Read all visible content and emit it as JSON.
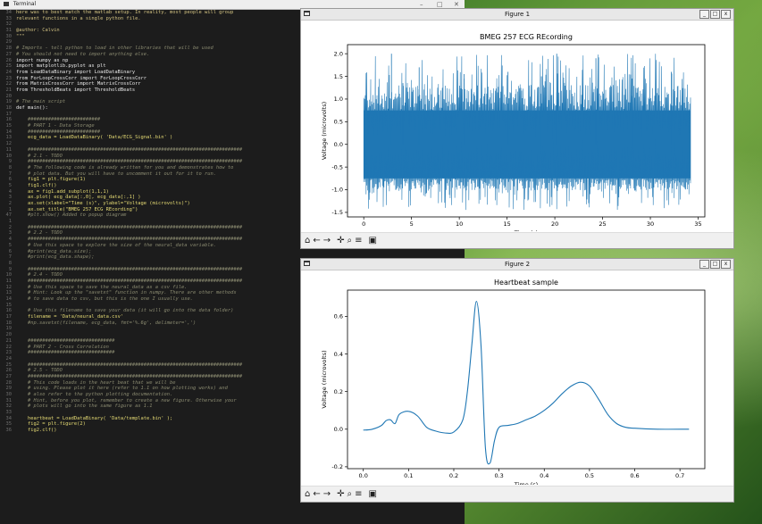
{
  "terminal": {
    "title": "Terminal",
    "controls": [
      "–",
      "□",
      "✕"
    ],
    "lines": [
      {
        "n": "34",
        "t": "here was to best match the matlab setup. In reality, most people will group",
        "k": "hdr"
      },
      {
        "n": "33",
        "t": "relevant functions in a single python file.",
        "k": "hdr"
      },
      {
        "n": "32",
        "t": "",
        "k": ""
      },
      {
        "n": "31",
        "t": "@author: Calvin",
        "k": "hdr"
      },
      {
        "n": "30",
        "t": "\"\"\"",
        "k": "hdr"
      },
      {
        "n": "29",
        "t": "",
        "k": ""
      },
      {
        "n": "28",
        "t": "# Imports - tell python to load in other libraries that will be used",
        "k": "cmt"
      },
      {
        "n": "27",
        "t": "# You should not need to import anything else.",
        "k": "cmt"
      },
      {
        "n": "26",
        "t": "import numpy as np",
        "k": "kw"
      },
      {
        "n": "25",
        "t": "import matplotlib.pyplot as plt",
        "k": "kw"
      },
      {
        "n": "24",
        "t": "from LoadDataBinary import LoadDataBinary",
        "k": "kw"
      },
      {
        "n": "23",
        "t": "from ForLoopCrossCorr import ForLoopCrossCorr",
        "k": "kw"
      },
      {
        "n": "22",
        "t": "from MatrixCrossCorr import MatrixCrossCorr",
        "k": "kw"
      },
      {
        "n": "21",
        "t": "from ThresholdBeats import ThresholdBeats",
        "k": "kw"
      },
      {
        "n": "20",
        "t": "",
        "k": ""
      },
      {
        "n": "19",
        "t": "# The main script",
        "k": "cmt"
      },
      {
        "n": "18",
        "t": "def main():",
        "k": "kw"
      },
      {
        "n": "17",
        "t": "",
        "k": ""
      },
      {
        "n": "16",
        "t": "    #########################",
        "k": "cmt"
      },
      {
        "n": "15",
        "t": "    # PART 1 - Data Storage",
        "k": "cmt"
      },
      {
        "n": "14",
        "t": "    #########################",
        "k": "cmt"
      },
      {
        "n": "13",
        "t": "    ecg_data = LoadDataBinary( 'Data/ECG_Signal.bin' )",
        "k": ""
      },
      {
        "n": "12",
        "t": "",
        "k": ""
      },
      {
        "n": "11",
        "t": "    ##########################################################################",
        "k": "cmt"
      },
      {
        "n": "10",
        "t": "    # 2.1 - TODO",
        "k": "cmt"
      },
      {
        "n": "9",
        "t": "    ##########################################################################",
        "k": "cmt"
      },
      {
        "n": "8",
        "t": "    # The following code is already written for you and demonstrates how to",
        "k": "cmt"
      },
      {
        "n": "7",
        "t": "    # plot data. But you will have to uncomment it out for it to run.",
        "k": "cmt"
      },
      {
        "n": "6",
        "t": "    fig1 = plt.figure(1)",
        "k": ""
      },
      {
        "n": "5",
        "t": "    fig1.clf()",
        "k": ""
      },
      {
        "n": "4",
        "t": "    ax = fig1.add_subplot(1,1,1)",
        "k": ""
      },
      {
        "n": "3",
        "t": "    ax.plot( ecg_data[:,0], ecg_data[:,1] )",
        "k": ""
      },
      {
        "n": "2",
        "t": "    ax.set(xlabel=\"Time (s)\", ylabel=\"Voltage (microvolts)\")",
        "k": ""
      },
      {
        "n": "1",
        "t": "    ax.set_title(\"BMEG 257 ECG REcording\")",
        "k": ""
      },
      {
        "n": "47",
        "t": "    #plt.show() Added to popup diagram",
        "k": "cmt"
      },
      {
        "n": "1",
        "t": "",
        "k": ""
      },
      {
        "n": "2",
        "t": "    ##########################################################################",
        "k": "cmt"
      },
      {
        "n": "3",
        "t": "    # 2.2 - TODO",
        "k": "cmt"
      },
      {
        "n": "4",
        "t": "    ##########################################################################",
        "k": "cmt"
      },
      {
        "n": "5",
        "t": "    # Use this space to explore the size of the neural_data variable.",
        "k": "cmt"
      },
      {
        "n": "6",
        "t": "    #print(ecg_data.size);",
        "k": "cmt"
      },
      {
        "n": "7",
        "t": "    #print(ecg_data.shape);",
        "k": "cmt"
      },
      {
        "n": "8",
        "t": "",
        "k": ""
      },
      {
        "n": "9",
        "t": "    ##########################################################################",
        "k": "cmt"
      },
      {
        "n": "10",
        "t": "    # 2.4 - TODO",
        "k": "cmt"
      },
      {
        "n": "11",
        "t": "    ##########################################################################",
        "k": "cmt"
      },
      {
        "n": "12",
        "t": "    # Use this space to save the neural_data as a csv file.",
        "k": "cmt"
      },
      {
        "n": "13",
        "t": "    # Hint: Look up the \"savetxt\" function in numpy. There are other methods",
        "k": "cmt"
      },
      {
        "n": "14",
        "t": "    # to save data to csv, but this is the one I usually use.",
        "k": "cmt"
      },
      {
        "n": "15",
        "t": "",
        "k": ""
      },
      {
        "n": "16",
        "t": "    # Use this filename to save your data (it will go into the data folder)",
        "k": "cmt"
      },
      {
        "n": "17",
        "t": "    filename = 'Data/neural_data.csv'",
        "k": ""
      },
      {
        "n": "18",
        "t": "    #np.savetxt(filename, ecg_data, fmt='%.6g', delimeter=',')",
        "k": "cmt"
      },
      {
        "n": "19",
        "t": "",
        "k": ""
      },
      {
        "n": "20",
        "t": "",
        "k": ""
      },
      {
        "n": "21",
        "t": "    ##############################",
        "k": "cmt"
      },
      {
        "n": "22",
        "t": "    # PART 2 - Cross Correlation",
        "k": "cmt"
      },
      {
        "n": "23",
        "t": "    ##############################",
        "k": "cmt"
      },
      {
        "n": "24",
        "t": "",
        "k": ""
      },
      {
        "n": "25",
        "t": "    ##########################################################################",
        "k": "cmt"
      },
      {
        "n": "26",
        "t": "    # 2.5 - TODO",
        "k": "cmt"
      },
      {
        "n": "27",
        "t": "    ##########################################################################",
        "k": "cmt"
      },
      {
        "n": "28",
        "t": "    # This code loads in the heart beat that we will be",
        "k": "cmt"
      },
      {
        "n": "29",
        "t": "    # using. Please plot it here (refer to 1.1 on how plotting works) and",
        "k": "cmt"
      },
      {
        "n": "30",
        "t": "    # also refer to the python plotting documentation.",
        "k": "cmt"
      },
      {
        "n": "31",
        "t": "    # Hint, before you plot, remember to create a new figure. Otherwise your",
        "k": "cmt"
      },
      {
        "n": "32",
        "t": "    # plots will go into the same figure as 1.1",
        "k": "cmt"
      },
      {
        "n": "33",
        "t": "",
        "k": ""
      },
      {
        "n": "34",
        "t": "    heartbeat = LoadDataBinary( 'Data/template.bin' );",
        "k": ""
      },
      {
        "n": "35",
        "t": "    fig2 = plt.figure(2)",
        "k": ""
      },
      {
        "n": "36",
        "t": "    fig2.clf()",
        "k": ""
      }
    ]
  },
  "figure1": {
    "window_title": "Figure 1",
    "window_buttons": [
      "_",
      "□",
      "x"
    ],
    "toolbar_icons": [
      "home-icon",
      "back-icon",
      "forward-icon",
      "pan-icon",
      "zoom-icon",
      "configure-icon",
      "save-icon"
    ],
    "toolbar_glyphs": [
      "⌂",
      "←",
      "→",
      "✛",
      "⌕",
      "≡",
      "▣"
    ]
  },
  "figure2": {
    "window_title": "Figure 2",
    "window_buttons": [
      "_",
      "□",
      "x"
    ],
    "toolbar_icons": [
      "home-icon",
      "back-icon",
      "forward-icon",
      "pan-icon",
      "zoom-icon",
      "configure-icon",
      "save-icon"
    ],
    "toolbar_glyphs": [
      "⌂",
      "←",
      "→",
      "✛",
      "⌕",
      "≡",
      "▣"
    ]
  },
  "chart_data": [
    {
      "type": "line",
      "title": "BMEG 257 ECG REcording",
      "xlabel": "Time (s)",
      "ylabel": "Voltage (microvolts)",
      "xlim": [
        -1.7,
        35.7
      ],
      "ylim": [
        -1.6,
        2.2
      ],
      "xticks": [
        0,
        5,
        10,
        15,
        20,
        25,
        30,
        35
      ],
      "yticks": [
        -1.5,
        -1.0,
        -0.5,
        0.0,
        0.5,
        1.0,
        1.5,
        2.0
      ],
      "color": "#1f77b4",
      "envelope": {
        "x_start": 0,
        "x_end": 34.2,
        "dense_low": -0.75,
        "dense_high": 0.75,
        "peak_max": 2.0,
        "trough_min": -1.45
      },
      "series": [
        {
          "x": [
            0,
            2.9,
            4.1,
            5.8,
            10.5,
            15.1,
            18.6,
            20.2,
            24.3,
            28.1,
            32.2,
            34.2
          ],
          "y": [
            0.0,
            2.0,
            1.35,
            1.7,
            1.55,
            1.6,
            1.5,
            2.0,
            1.9,
            1.45,
            1.6,
            0.0
          ]
        }
      ]
    },
    {
      "type": "line",
      "title": "Heartbeat sample",
      "xlabel": "Time (s)",
      "ylabel": "Voltage (microvolts)",
      "xlim": [
        -0.035,
        0.755
      ],
      "ylim": [
        -0.21,
        0.74
      ],
      "xticks": [
        0.0,
        0.1,
        0.2,
        0.3,
        0.4,
        0.5,
        0.6,
        0.7
      ],
      "yticks": [
        -0.2,
        0.0,
        0.2,
        0.4,
        0.6
      ],
      "color": "#1f77b4",
      "series": [
        {
          "x": [
            0.0,
            0.02,
            0.04,
            0.05,
            0.06,
            0.07,
            0.08,
            0.1,
            0.12,
            0.14,
            0.16,
            0.18,
            0.2,
            0.22,
            0.23,
            0.24,
            0.25,
            0.26,
            0.27,
            0.28,
            0.29,
            0.3,
            0.32,
            0.34,
            0.36,
            0.38,
            0.4,
            0.42,
            0.44,
            0.46,
            0.48,
            0.5,
            0.52,
            0.54,
            0.56,
            0.58,
            0.6,
            0.65,
            0.72
          ],
          "y": [
            -0.005,
            0.0,
            0.02,
            0.045,
            0.05,
            0.03,
            0.08,
            0.095,
            0.07,
            0.01,
            -0.01,
            -0.02,
            -0.015,
            0.05,
            0.2,
            0.45,
            0.68,
            0.45,
            -0.1,
            -0.18,
            -0.06,
            0.01,
            0.02,
            0.03,
            0.05,
            0.07,
            0.1,
            0.14,
            0.19,
            0.23,
            0.25,
            0.23,
            0.16,
            0.08,
            0.03,
            0.01,
            0.005,
            0.0,
            0.0
          ]
        }
      ]
    }
  ]
}
